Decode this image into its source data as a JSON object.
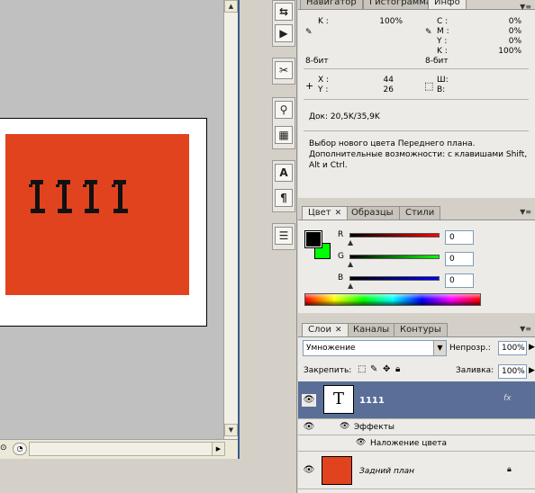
{
  "canvas": {
    "text_layer_content": "1111",
    "fill_color": "#e2431f"
  },
  "panel_info": {
    "tabs": [
      "Навигатор",
      "Гистограмма",
      "Инфо"
    ],
    "rows": {
      "k_label": "K :",
      "k_value": "100%",
      "c_label": "C :",
      "c_value": "0%",
      "m_label": "M :",
      "m_value": "0%",
      "y_label": "Y :",
      "y_value": "0%",
      "k2_label": "K :",
      "k2_value": "100%",
      "bit_left": "8-бит",
      "bit_right": "8-бит",
      "x_label": "X :",
      "x_value": "44",
      "y2_label": "Y :",
      "y2_value": "26",
      "w_label": "Ш:",
      "h_label": "В:",
      "doc": "Док: 20,5K/35,9K",
      "hint_line1": "Выбор нового цвета Переднего плана.",
      "hint_line2": "Дополнительные возможности: с клавишами Shift,",
      "hint_line3": "Alt и Ctrl."
    }
  },
  "panel_color": {
    "tabs": [
      "Цвет",
      "Образцы",
      "Стили"
    ],
    "foreground": "#000000",
    "background": "#00ff00",
    "channels": [
      {
        "label": "R",
        "value": "0",
        "color": "#ff0000"
      },
      {
        "label": "G",
        "value": "0",
        "color": "#00ff00"
      },
      {
        "label": "B",
        "value": "0",
        "color": "#0000ff"
      }
    ]
  },
  "panel_layers": {
    "tabs": [
      "Слои",
      "Каналы",
      "Контуры"
    ],
    "blend_mode": "Умножение",
    "opacity_label": "Непрозр.:",
    "opacity_value": "100%",
    "lock_label": "Закрепить:",
    "fill_label": "Заливка:",
    "fill_value": "100%",
    "layers": {
      "text_layer_name": "1111",
      "effects_label": "Эффекты",
      "effect_name": "Наложение цвета",
      "background_name": "Задний план"
    }
  }
}
